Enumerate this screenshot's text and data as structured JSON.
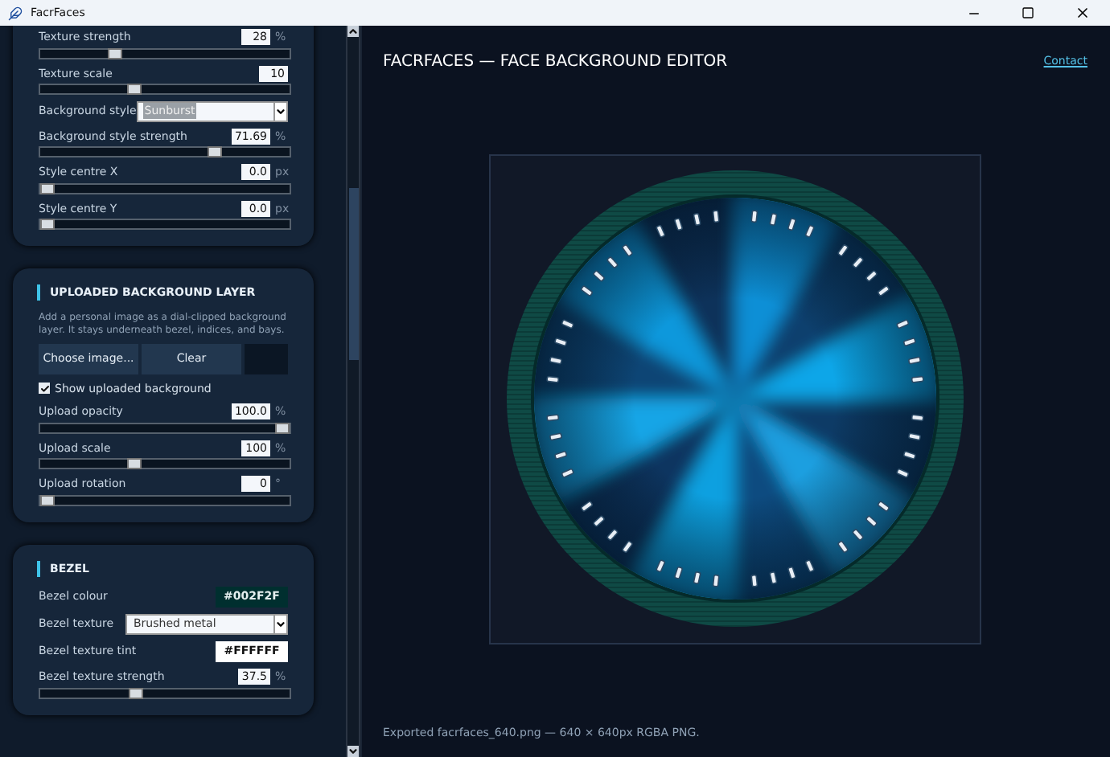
{
  "window": {
    "title": "FacrFaces"
  },
  "sections": [
    {
      "controls": [
        {
          "kind": "slider",
          "label": "Texture strength",
          "value": "28",
          "unit": "%",
          "level": 0.29
        },
        {
          "kind": "slider",
          "label": "Texture scale",
          "value": "10",
          "level": 0.37
        },
        {
          "kind": "dropdown",
          "label": "Background style",
          "value": "Sunburst",
          "selected_text": true
        },
        {
          "kind": "slider",
          "label": "Background style strength",
          "value": "71.69",
          "unit": "%",
          "level": 0.71
        },
        {
          "kind": "slider",
          "label": "Style centre X",
          "value": "0.0",
          "unit": "px",
          "level": 0
        },
        {
          "kind": "slider",
          "label": "Style centre Y",
          "value": "0.0",
          "unit": "px",
          "level": 0
        }
      ]
    },
    {
      "title": "UPLOADED BACKGROUND LAYER",
      "description": "Add a personal image as a dial-clipped background layer. It stays underneath bezel, indices, and bays.",
      "buttons": [
        "Choose image...",
        "Clear"
      ],
      "checkbox": {
        "label": "Show uploaded background",
        "checked": true
      },
      "controls": [
        {
          "kind": "slider",
          "label": "Upload opacity",
          "value": "100.0",
          "unit": "%",
          "level": 1
        },
        {
          "kind": "slider",
          "label": "Upload scale",
          "value": "100",
          "unit": "%",
          "level": 0.37
        },
        {
          "kind": "slider",
          "label": "Upload rotation",
          "value": "0",
          "unit": "°",
          "level": 0
        }
      ]
    },
    {
      "title": "BEZEL",
      "controls": [
        {
          "kind": "color",
          "label": "Bezel colour",
          "value": "#002F2F",
          "color": "#002f2f"
        },
        {
          "kind": "dropdown",
          "label": "Bezel texture",
          "value": "Brushed metal",
          "selected_text": false
        },
        {
          "kind": "color",
          "label": "Bezel texture tint",
          "value": "#FFFFFF",
          "color": "#ffffff"
        },
        {
          "kind": "slider",
          "label": "Bezel texture strength",
          "value": "37.5",
          "unit": "%",
          "level": 0.38
        }
      ]
    }
  ],
  "header": {
    "title": "FACRFACES — FACE BACKGROUND EDITOR",
    "link": "Contact"
  },
  "status": "Exported facrfaces_640.png — 640 × 640px RGBA PNG."
}
